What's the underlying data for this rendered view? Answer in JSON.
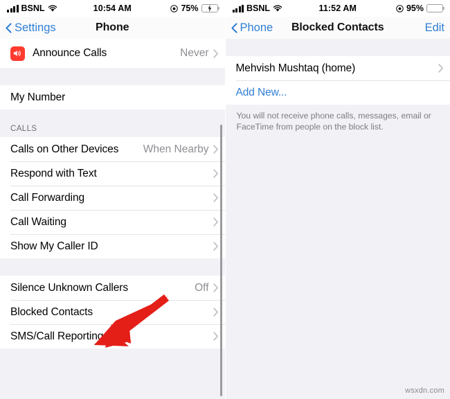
{
  "left_panel": {
    "status_bar": {
      "carrier": "BSNL",
      "time": "10:54 AM",
      "battery_percent": "75%",
      "battery_level": 75,
      "charging": true,
      "signal_icon": "cellular-bars-icon",
      "wifi_icon": "wifi-icon",
      "location_icon": "location-services-icon",
      "battery_icon": "battery-charging-icon"
    },
    "nav": {
      "back_label": "Settings",
      "title": "Phone",
      "back_icon": "chevron-left-icon"
    },
    "groups": [
      {
        "header": "",
        "rows": [
          {
            "label": "Announce Calls",
            "value": "Never",
            "icon": "speaker-announce-icon",
            "chevron": true
          }
        ]
      },
      {
        "header": "",
        "rows": [
          {
            "label": "My Number",
            "value": "",
            "chevron": false
          }
        ]
      },
      {
        "header": "CALLS",
        "rows": [
          {
            "label": "Calls on Other Devices",
            "value": "When Nearby",
            "chevron": true
          },
          {
            "label": "Respond with Text",
            "value": "",
            "chevron": true
          },
          {
            "label": "Call Forwarding",
            "value": "",
            "chevron": true
          },
          {
            "label": "Call Waiting",
            "value": "",
            "chevron": true
          },
          {
            "label": "Show My Caller ID",
            "value": "",
            "chevron": true
          }
        ]
      },
      {
        "header": "",
        "rows": [
          {
            "label": "Silence Unknown Callers",
            "value": "Off",
            "chevron": true
          },
          {
            "label": "Blocked Contacts",
            "value": "",
            "chevron": true
          },
          {
            "label": "SMS/Call Reporting",
            "value": "",
            "chevron": true
          }
        ]
      }
    ],
    "annotation": {
      "type": "arrow",
      "color": "#e41f18",
      "points_to": "Blocked Contacts"
    }
  },
  "right_panel": {
    "status_bar": {
      "carrier": "BSNL",
      "time": "11:52 AM",
      "battery_percent": "95%",
      "battery_level": 95,
      "charging": false,
      "signal_icon": "cellular-bars-icon",
      "wifi_icon": "wifi-icon",
      "location_icon": "location-services-icon",
      "battery_icon": "battery-icon"
    },
    "nav": {
      "back_label": "Phone",
      "title": "Blocked Contacts",
      "action_label": "Edit",
      "back_icon": "chevron-left-icon"
    },
    "rows": [
      {
        "label": "Mehvish Mushtaq (home)",
        "chevron": true,
        "link": false
      },
      {
        "label": "Add New...",
        "chevron": false,
        "link": true
      }
    ],
    "footnote": "You will not receive phone calls, messages, email or FaceTime from people on the block list."
  },
  "watermark": "wsxdn.com",
  "colors": {
    "accent_blue": "#2f7fd4",
    "group_background": "#f2f2f6",
    "row_background": "#ffffff",
    "secondary_text": "#8e8e93",
    "annotation_red": "#e41f18",
    "announce_icon_red": "#ff3b30"
  }
}
